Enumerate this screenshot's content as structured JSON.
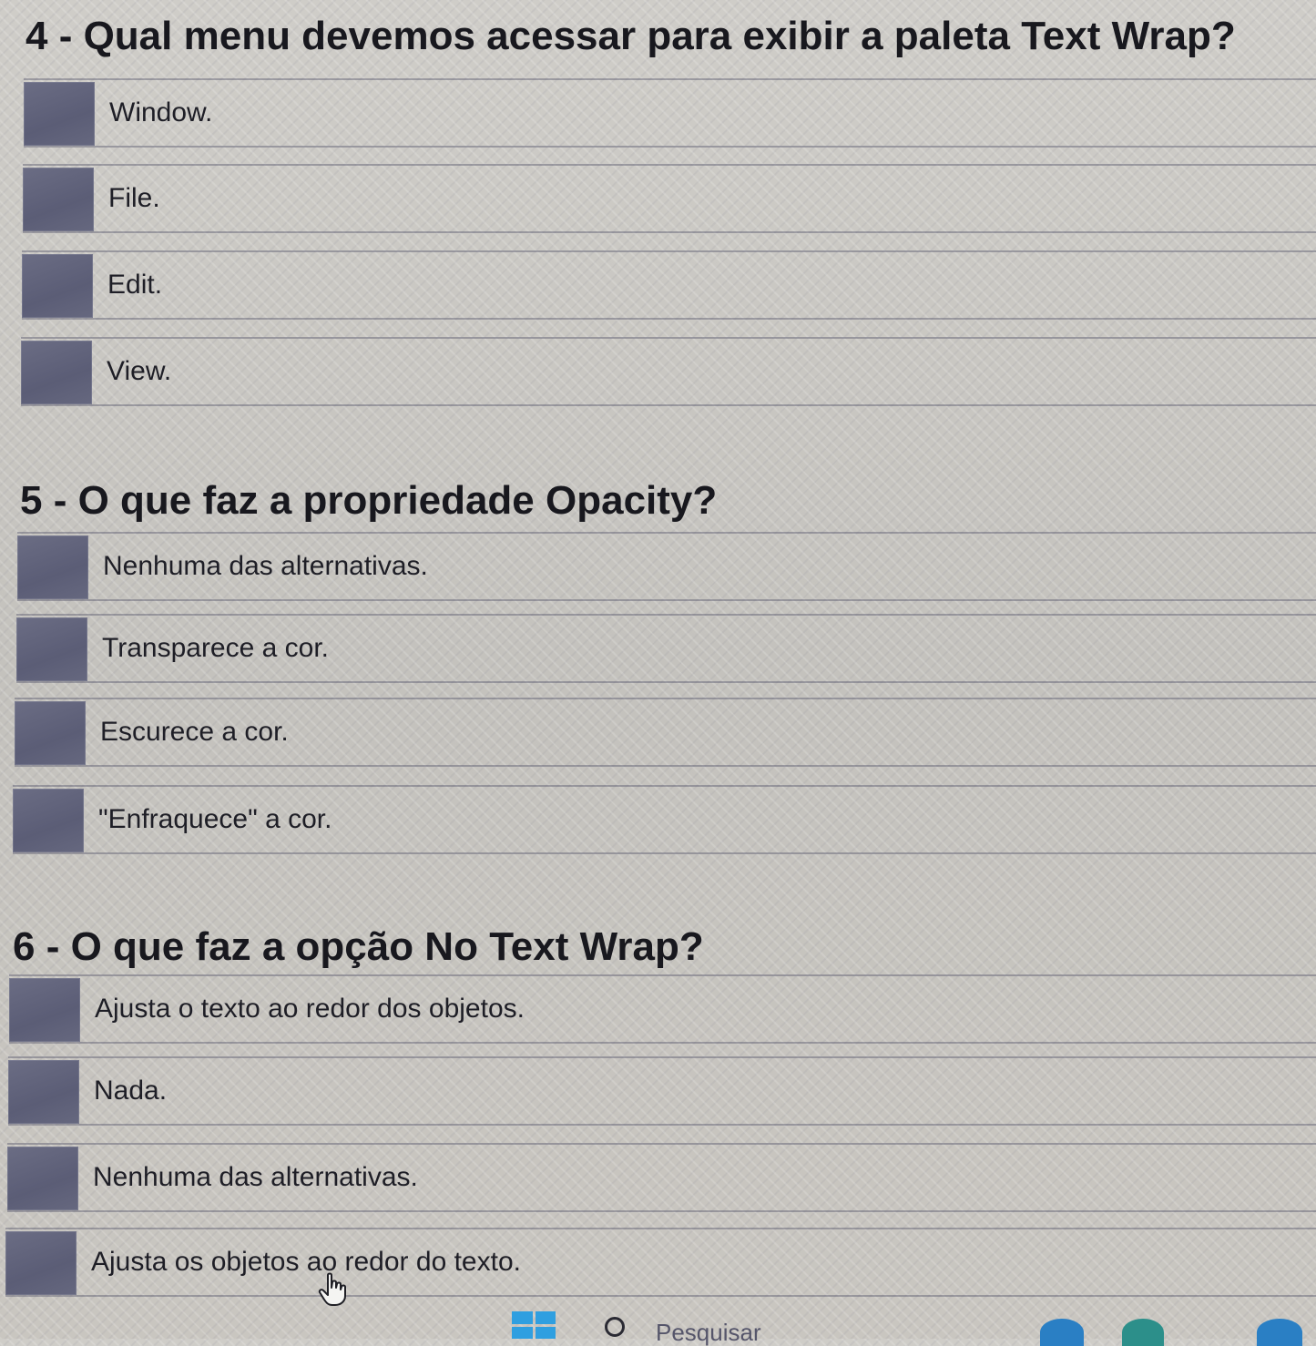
{
  "questions": [
    {
      "title": "4 - Qual menu devemos acessar para exibir a paleta Text Wrap?",
      "options": [
        "Window.",
        "File.",
        "Edit.",
        "View."
      ]
    },
    {
      "title": "5 - O que faz a propriedade Opacity?",
      "options": [
        "Nenhuma das alternativas.",
        "Transparece a cor.",
        "Escurece a cor.",
        "\"Enfraquece\" a cor."
      ]
    },
    {
      "title": "6 - O que faz a opção No Text Wrap?",
      "options": [
        "Ajusta o texto ao redor dos objetos.",
        "Nada.",
        "Nenhuma das alternativas.",
        "Ajusta os objetos ao redor do texto."
      ]
    }
  ],
  "taskbar": {
    "search_placeholder": "Pesquisar"
  },
  "colors": {
    "radio_box": "#5f6179",
    "windows_logo": "#2f9fe0",
    "tray_blue": "#2a7fc4",
    "tray_teal": "#2c8f8a"
  },
  "icons": [
    "windows-logo-icon",
    "search-icon",
    "hand-cursor-icon"
  ]
}
